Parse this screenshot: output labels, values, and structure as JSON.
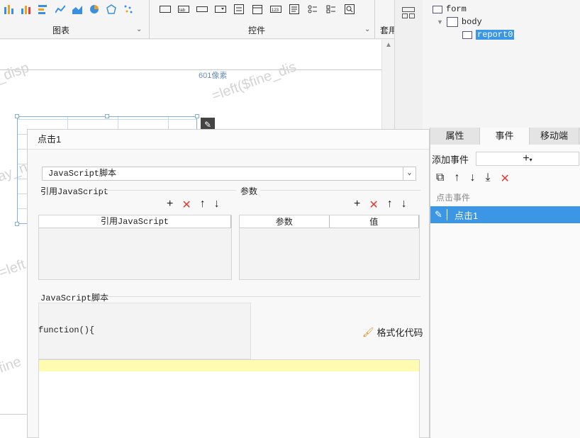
{
  "toolbar": {
    "group1_label": "图表",
    "group2_label": "控件",
    "group3_label": "套用"
  },
  "canvas": {
    "ruler_text": "601像素",
    "watermarks": [
      "_disp",
      "=left($fine_dis",
      "ay_n",
      "=left",
      "fine"
    ]
  },
  "tree": {
    "form": "form",
    "body": "body",
    "report": "report0"
  },
  "panel": {
    "tabs": [
      "属性",
      "事件",
      "移动端"
    ],
    "add_event_label": "添加事件",
    "event_group": "点击事件",
    "event_item": "点击1"
  },
  "dialog": {
    "title": "点击1",
    "type_value": "JavaScript脚本",
    "ref_js_label": "引用JavaScript",
    "params_label": "参数",
    "ref_js_header": "引用JavaScript",
    "param_col": "参数",
    "value_col": "值",
    "js_section_label": "JavaScript脚本",
    "function_text": "function(){",
    "format_label": "格式化代码"
  }
}
